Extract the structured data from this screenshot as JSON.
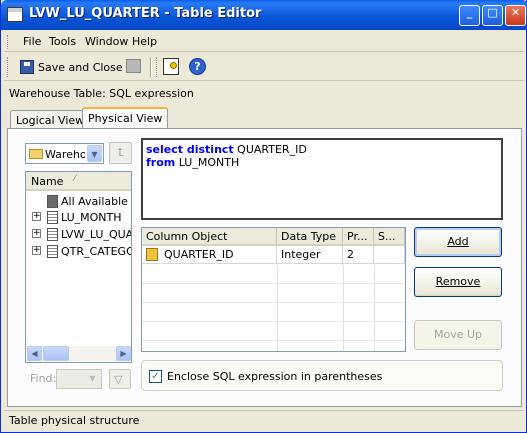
{
  "window": {
    "title": "LVW_LU_QUARTER - Table Editor",
    "minimize": "_",
    "maximize": "□",
    "close": "✕"
  },
  "menu": [
    "File",
    "Tools",
    "Window",
    "Help"
  ],
  "toolbar": {
    "save_close": "Save and Close"
  },
  "header_label": "Warehouse Table: SQL expression",
  "tabs": [
    {
      "label": "Logical View",
      "active": false
    },
    {
      "label": "Physical View",
      "active": true
    }
  ],
  "left": {
    "combo_value": "Wareho",
    "tree_header": "Name",
    "tree_items": [
      "All Available Ta",
      "LU_MONTH",
      "LVW_LU_QUAR",
      "QTR_CATEGOR"
    ],
    "find_label": "Find:"
  },
  "sql": {
    "line1_kw": "select distinct",
    "line1_rest": " QUARTER_ID",
    "line2_kw": "from",
    "line2_rest": " LU_MONTH"
  },
  "grid": {
    "columns": [
      "Column Object",
      "Data Type",
      "Pr...",
      "S..."
    ],
    "rows": [
      {
        "object": "QUARTER_ID",
        "type": "Integer",
        "precision": "2",
        "scale": ""
      }
    ]
  },
  "buttons": {
    "add": "Add",
    "remove": "Remove",
    "move_up": "Move Up"
  },
  "checkbox": {
    "label": "Enclose SQL expression in parentheses",
    "checked": true
  },
  "status": "Table physical structure"
}
